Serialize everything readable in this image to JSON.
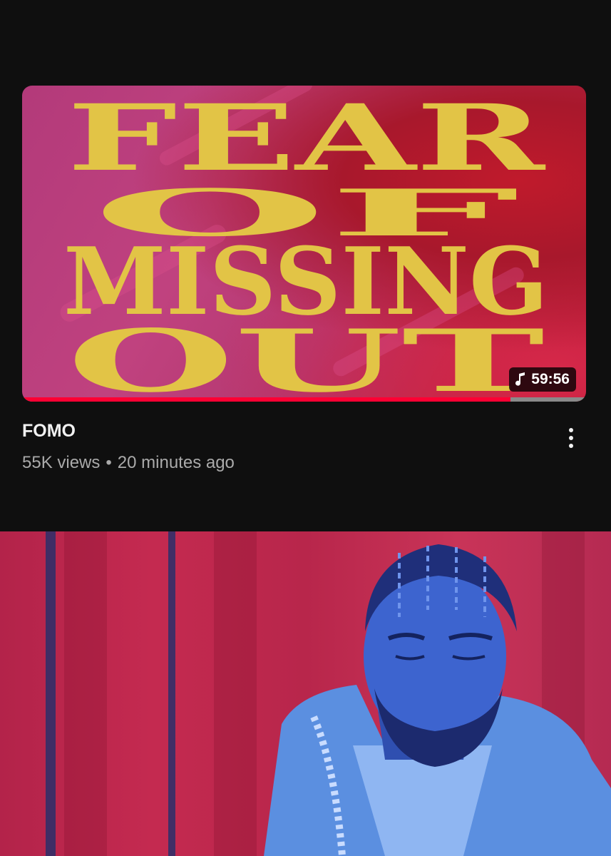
{
  "video": {
    "thumbnail_text": [
      "FEAR",
      "OF",
      "MISSING",
      "OUT"
    ],
    "duration": "59:56",
    "duration_icon": "music-note-icon",
    "progress_fraction": 0.866,
    "title": "FOMO",
    "views": "55K views",
    "separator": "•",
    "age": "20 minutes ago",
    "menu_icon": "more-vert-icon"
  },
  "colors": {
    "background": "#0f0f0f",
    "title_art": "#e2c446",
    "progress": "#ff0033"
  }
}
